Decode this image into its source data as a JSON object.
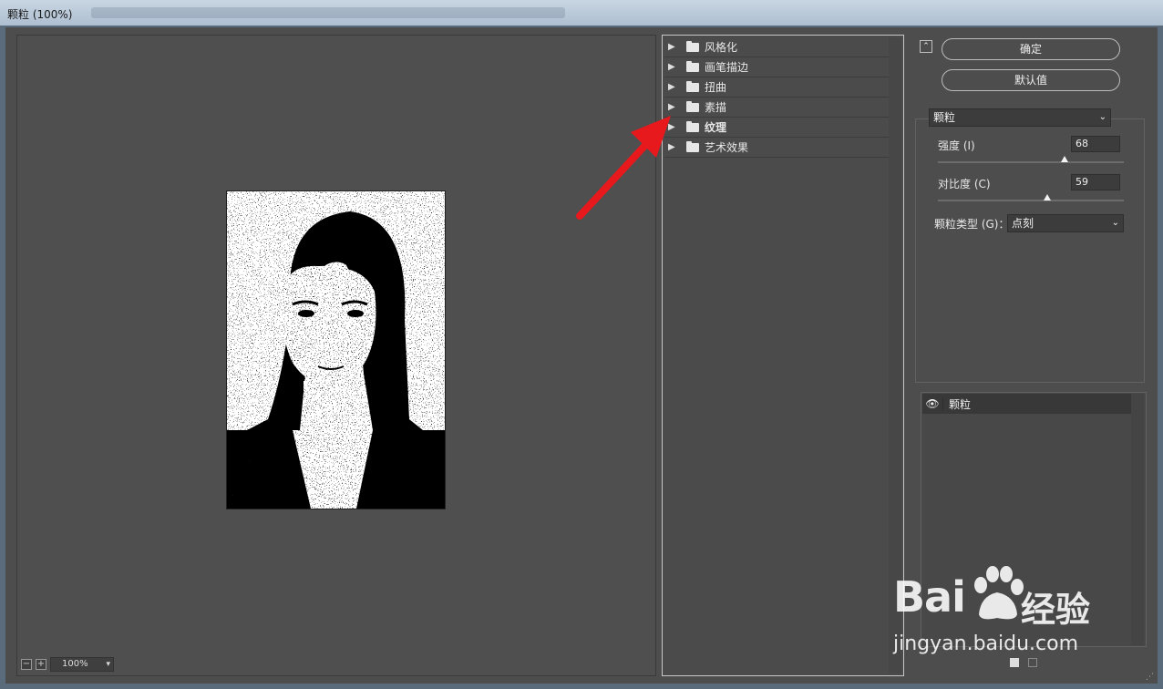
{
  "window": {
    "title": "颗粒 (100%)"
  },
  "preview": {
    "zoom_value": "100%",
    "zoom_minus": "−",
    "zoom_plus": "+"
  },
  "gallery": {
    "categories": [
      {
        "label": "风格化",
        "expanded": false
      },
      {
        "label": "画笔描边",
        "expanded": false
      },
      {
        "label": "扭曲",
        "expanded": false
      },
      {
        "label": "素描",
        "expanded": false
      },
      {
        "label": "纹理",
        "expanded": false,
        "bold": true
      },
      {
        "label": "艺术效果",
        "expanded": false
      }
    ]
  },
  "buttons": {
    "ok": "确定",
    "default": "默认值"
  },
  "filter_select": {
    "value": "颗粒"
  },
  "params": {
    "intensity": {
      "label": "强度 (I)",
      "value": "68",
      "slider_fraction": 0.68
    },
    "contrast": {
      "label": "对比度 (C)",
      "value": "59",
      "slider_fraction": 0.59
    },
    "grain_type": {
      "label": "颗粒类型 (G)：",
      "value": "点刻"
    }
  },
  "layers": [
    {
      "name": "颗粒",
      "visible": true
    }
  ],
  "watermark": {
    "brand": "Bai",
    "suffix": "经验",
    "url": "jingyan.baidu.com"
  },
  "colors": {
    "dialog_bg": "#4d4d4d",
    "arrow": "#e8191c",
    "titlebar": "#bfcfdf"
  }
}
